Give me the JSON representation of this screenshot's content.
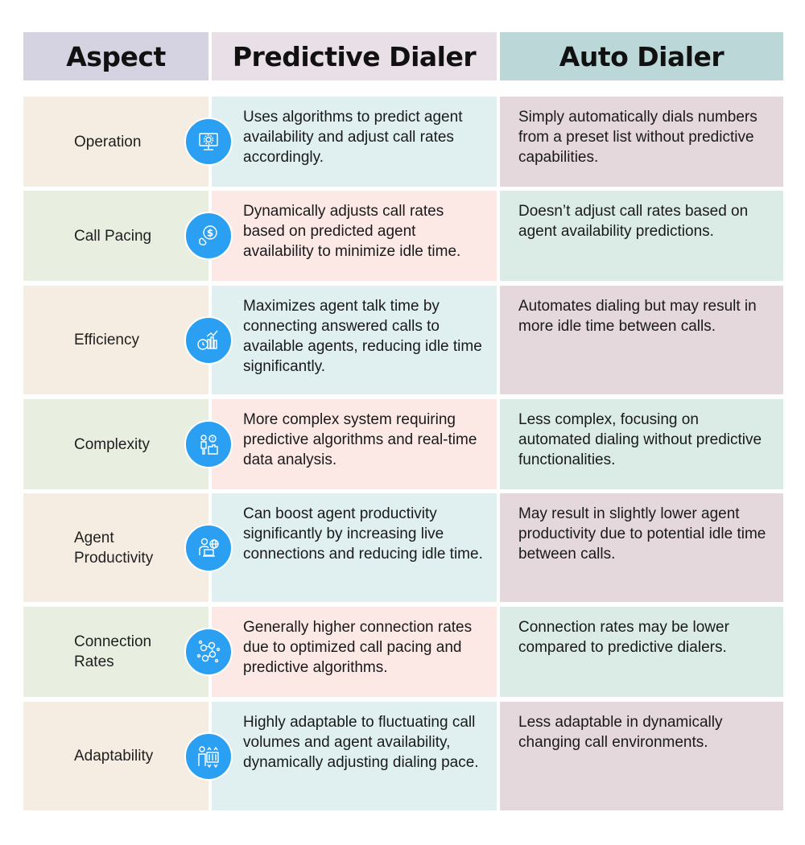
{
  "header": {
    "aspect": "Aspect",
    "predictive": "Predictive Dialer",
    "auto": "Auto Dialer"
  },
  "rows": [
    {
      "aspect": "Operation",
      "icon": "monitor-gear-icon",
      "predictive": "Uses algorithms to predict agent availability and adjust call rates accordingly.",
      "auto": "Simply automatically dials numbers from a preset list without predictive capabilities."
    },
    {
      "aspect": "Call Pacing",
      "icon": "phone-dollar-icon",
      "predictive": "Dynamically adjusts call rates based on predicted agent availability to minimize idle time.",
      "auto": "Doesn’t adjust call rates based on agent availability predictions."
    },
    {
      "aspect": "Efficiency",
      "icon": "clock-chart-icon",
      "predictive": "Maximizes agent talk time by connecting answered calls to available agents, reducing idle time significantly.",
      "auto": "Automates dialing but may result in more idle time between calls."
    },
    {
      "aspect": "Complexity",
      "icon": "person-puzzle-icon",
      "predictive": "More complex system requiring predictive algorithms and real-time data analysis.",
      "auto": "Less complex, focusing on automated dialing without predictive functionalities."
    },
    {
      "aspect": "Agent Productivity",
      "icon": "agent-globe-laptop-icon",
      "predictive": "Can boost agent productivity significantly by increasing live connections and reducing idle time.",
      "auto": "May result in slightly lower agent productivity due to potential idle time between calls."
    },
    {
      "aspect": "Connection Rates",
      "icon": "network-people-icon",
      "predictive": "Generally higher connection rates due to optimized call pacing and predictive algorithms.",
      "auto": "Connection rates may be lower compared to predictive dialers."
    },
    {
      "aspect": "Adaptability",
      "icon": "person-sliders-icon",
      "predictive": "Highly adaptable to fluctuating call volumes and agent availability, dynamically adjusting dialing pace.",
      "auto": "Less adaptable in dynamically changing call environments."
    }
  ],
  "colors": {
    "icon_circle": "#2b9ff2",
    "header_aspect": "#d5d3e1",
    "header_predictive": "#e9dfe6",
    "header_auto": "#bcd7d7"
  }
}
